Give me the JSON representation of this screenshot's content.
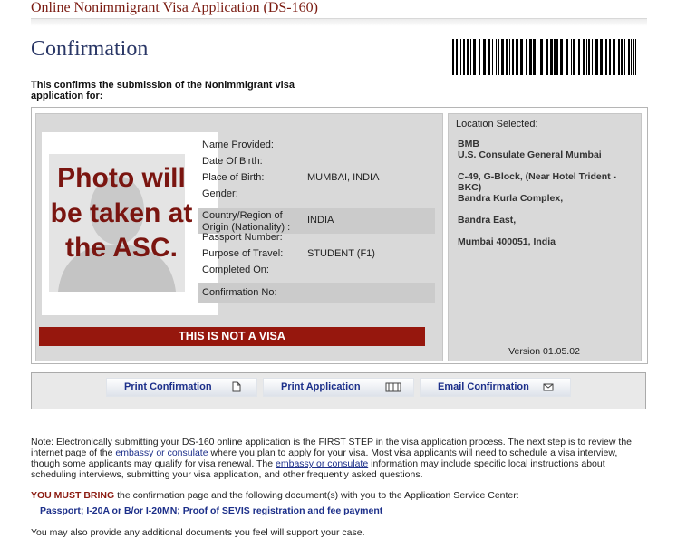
{
  "app_title": "Online Nonimmigrant Visa Application (DS-160)",
  "page_title": "Confirmation",
  "intro": "This confirms the submission of the Nonimmigrant visa application for:",
  "photo_text": "Photo will be taken at the ASC.",
  "applicant": {
    "rows": [
      {
        "label": "Name Provided:",
        "value": "",
        "shaded": false
      },
      {
        "label": "Date Of Birth:",
        "value": "",
        "shaded": false
      },
      {
        "label": "Place of Birth:",
        "value": "MUMBAI, INDIA",
        "shaded": false
      },
      {
        "label": "Gender:",
        "value": "",
        "shaded": false
      },
      {
        "label": "Country/Region of Origin (Nationality) :",
        "value": "INDIA",
        "shaded": true
      },
      {
        "label": "Passport Number:",
        "value": "",
        "shaded": false
      },
      {
        "label": "Purpose of Travel:",
        "value": "STUDENT (F1)",
        "shaded": false
      },
      {
        "label": "Completed On:",
        "value": "",
        "shaded": false
      },
      {
        "label": "Confirmation No:",
        "value": "",
        "shaded": true
      }
    ]
  },
  "warning": "THIS IS NOT A VISA",
  "location": {
    "label": "Location Selected:",
    "lines": [
      "BMB",
      "U.S. Consulate General Mumbai",
      "C-49, G-Block, (Near Hotel Trident -",
      "BKC)",
      "Bandra Kurla Complex,",
      "Bandra East,",
      "Mumbai 400051, India"
    ]
  },
  "version": "Version 01.05.02",
  "actions": {
    "print_confirmation": "Print Confirmation",
    "print_application": "Print Application",
    "email_confirmation": "Email Confirmation"
  },
  "note": {
    "p1": "Note: Electronically submitting your DS-160 online application is the FIRST STEP in the visa application process. The next step is to review the internet page of the ",
    "link1": "embassy or consulate",
    "p2": " where you plan to apply for your visa. Most visa applicants will need to schedule a visa interview, though some applicants may qualify for visa renewal. The ",
    "link2": "embassy or consulate",
    "p3": " information may include specific local instructions about scheduling interviews, submitting your visa application, and other frequently asked questions."
  },
  "must_bring": {
    "emphasis": "YOU MUST BRING",
    "text": " the confirmation page and the following document(s) with you to the Application Service Center:",
    "documents": "Passport; I-20A or B/or I-20MN; Proof of SEVIS registration and fee payment"
  },
  "also_note": "You may also provide any additional documents you feel will support your case.",
  "colors": {
    "accent_red": "#96170d",
    "title_blue": "#2a3766",
    "link_blue": "#1c2f8a"
  }
}
